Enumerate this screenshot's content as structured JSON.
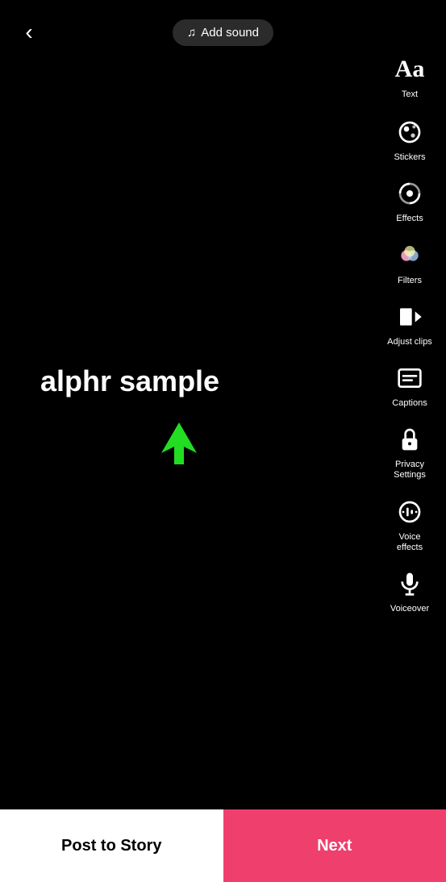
{
  "header": {
    "back_label": "‹",
    "add_sound_label": "Add sound",
    "music_icon": "♫"
  },
  "sidebar": {
    "items": [
      {
        "id": "text",
        "label": "Text",
        "icon": "text"
      },
      {
        "id": "stickers",
        "label": "Stickers",
        "icon": "stickers"
      },
      {
        "id": "effects",
        "label": "Effects",
        "icon": "effects"
      },
      {
        "id": "filters",
        "label": "Filters",
        "icon": "filters"
      },
      {
        "id": "adjust-clips",
        "label": "Adjust clips",
        "icon": "adjust-clips"
      },
      {
        "id": "captions",
        "label": "Captions",
        "icon": "captions"
      },
      {
        "id": "privacy-settings",
        "label": "Privacy Settings",
        "icon": "privacy"
      },
      {
        "id": "voice-effects",
        "label": "Voice effects",
        "icon": "voice-effects"
      },
      {
        "id": "voiceover",
        "label": "Voiceover",
        "icon": "voiceover"
      }
    ]
  },
  "canvas": {
    "sample_text": "alphr sample"
  },
  "bottom": {
    "post_to_story_label": "Post to Story",
    "next_label": "Next"
  }
}
